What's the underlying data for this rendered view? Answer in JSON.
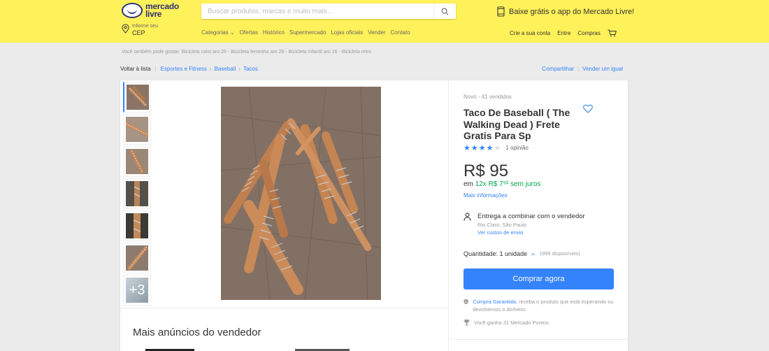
{
  "header": {
    "logo_line1": "mercado",
    "logo_line2": "livre",
    "search_placeholder": "Buscar produtos, marcas e muito mais…",
    "app_promo": "Baixe grátis o app do Mercado Livre!",
    "location_small": "Informe seu",
    "location_big": "CEP",
    "nav": [
      "Categorias ⌄",
      "Ofertas",
      "Histórico",
      "Supermercado",
      "Lojas oficiais",
      "Vender",
      "Contato"
    ],
    "user_nav": [
      "Crie a sua conta",
      "Entre",
      "Compras"
    ],
    "colors": {
      "brand_yellow": "#fff159",
      "brand_blue": "#2d3277"
    }
  },
  "suggestions": "Você também pode gostar: Bicicleta caloi aro 26 - Bicicleta feminina aro 26 - Bicicleta infantil aro 16 - Bicicleta retro",
  "breadcrumb": {
    "back": "Voltar à lista",
    "items": [
      "Esportes e Fitness",
      "Baseball",
      "Tacos"
    ],
    "share": "Compartilhar",
    "sell_same": "Vender um igual"
  },
  "gallery": {
    "thumb_count": 7,
    "more_label": "+3"
  },
  "more_ads": {
    "title": "Mais anúncios do vendedor"
  },
  "product": {
    "condition": "Novo  -  41 vendidos",
    "title": "Taco De Baseball ( The Walking Dead ) Frete Gratis Para Sp",
    "rating_value": 4,
    "rating_max": 5,
    "rating_text": "1 opinião",
    "currency": "R$",
    "price": "95",
    "installments_prefix": "em",
    "installments_green": "12x R$ 7⁹² sem juros",
    "more_info": "Mais informações",
    "shipping_main": "Entrega a combinar com o vendedor",
    "shipping_location": "Rio Claro, São Paulo",
    "shipping_link": "Ver custos de envio",
    "quantity_label": "Quantidade: 1 unidade",
    "quantity_available": "(959 disponíveis)",
    "buy_button": "Comprar agora",
    "guarantee_link": "Compra Garantida",
    "guarantee_text": ", receba o produto que está esperando ou devolvemos o dinheiro.",
    "points_text": "Você ganha 31 Mercado Pontos.",
    "colors": {
      "accent": "#3483fa",
      "green": "#00a650"
    }
  }
}
